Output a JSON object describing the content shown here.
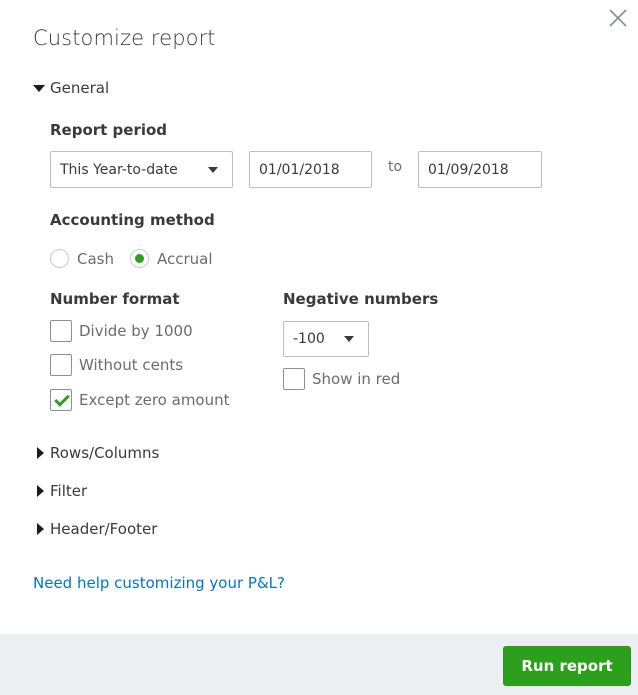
{
  "dialog": {
    "title": "Customize report",
    "close_icon": "close-icon"
  },
  "general": {
    "label": "General",
    "expanded": true,
    "report_period": {
      "label": "Report period",
      "selected": "This Year-to-date",
      "from": "01/01/2018",
      "to_label": "to",
      "to": "01/09/2018"
    },
    "accounting_method": {
      "label": "Accounting method",
      "options": [
        {
          "label": "Cash",
          "checked": false
        },
        {
          "label": "Accrual",
          "checked": true
        }
      ]
    },
    "number_format": {
      "label": "Number format",
      "options": [
        {
          "label": "Divide by 1000",
          "checked": false
        },
        {
          "label": "Without cents",
          "checked": false
        },
        {
          "label": "Except zero amount",
          "checked": true
        }
      ]
    },
    "negative_numbers": {
      "label": "Negative numbers",
      "selected": "-100",
      "show_in_red": {
        "label": "Show in red",
        "checked": false
      }
    }
  },
  "sections": [
    {
      "label": "Rows/Columns",
      "expanded": false
    },
    {
      "label": "Filter",
      "expanded": false
    },
    {
      "label": "Header/Footer",
      "expanded": false
    }
  ],
  "help_link": "Need help customizing your P&L?",
  "footer": {
    "run_report_label": "Run report"
  },
  "colors": {
    "accent_green": "#2ca01c",
    "link_blue": "#0077c5",
    "footer_bg": "#eceef1"
  }
}
